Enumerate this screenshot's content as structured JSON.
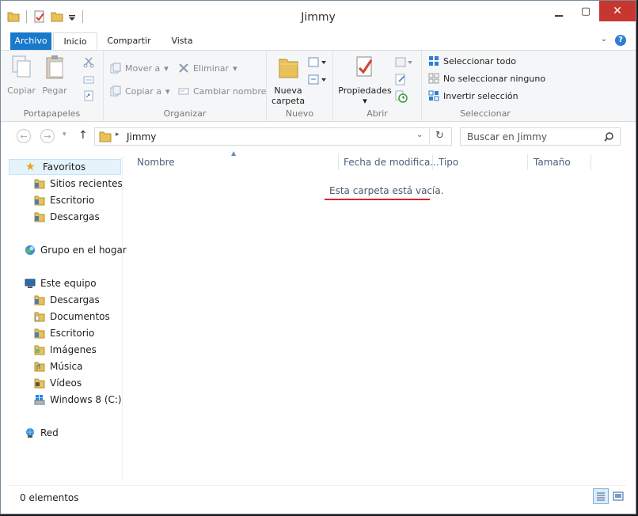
{
  "window": {
    "title": "Jimmy"
  },
  "quick_access": {
    "icons": [
      "folder-icon",
      "properties-icon",
      "new-folder-icon",
      "customize-icon"
    ]
  },
  "ribbon_tabs": [
    {
      "label": "Archivo"
    },
    {
      "label": "Inicio"
    },
    {
      "label": "Compartir"
    },
    {
      "label": "Vista"
    }
  ],
  "ribbon": {
    "clipboard": {
      "label": "Portapapeles",
      "copy": "Copiar",
      "paste": "Pegar"
    },
    "organize": {
      "label": "Organizar",
      "move_to": "Mover a",
      "copy_to": "Copiar a",
      "delete": "Eliminar",
      "rename": "Cambiar nombre"
    },
    "new": {
      "label": "Nuevo",
      "new_folder_line1": "Nueva",
      "new_folder_line2": "carpeta"
    },
    "open": {
      "label": "Abrir",
      "properties": "Propiedades"
    },
    "select": {
      "label": "Seleccionar",
      "select_all": "Seleccionar todo",
      "select_none": "No seleccionar ninguno",
      "invert": "Invertir selección"
    }
  },
  "address": {
    "path": "Jimmy",
    "search_placeholder": "Buscar en Jimmy"
  },
  "nav": {
    "favorites": "Favoritos",
    "recent": "Sitios recientes",
    "desktop": "Escritorio",
    "downloads": "Descargas",
    "homegroup": "Grupo en el hogar",
    "this_pc": "Este equipo",
    "pc_items": [
      "Descargas",
      "Documentos",
      "Escritorio",
      "Imágenes",
      "Música",
      "Vídeos",
      "Windows 8 (C:)"
    ],
    "network": "Red"
  },
  "columns": {
    "name": "Nombre",
    "date": "Fecha de modifica...",
    "type": "Tipo",
    "size": "Tamaño"
  },
  "empty_message": "Esta carpeta está vacía.",
  "status": {
    "count": "0 elementos"
  },
  "colors": {
    "accent": "#1979ca",
    "close": "#c7372f",
    "underline": "#d7252f",
    "folder": "#e8c15a"
  }
}
